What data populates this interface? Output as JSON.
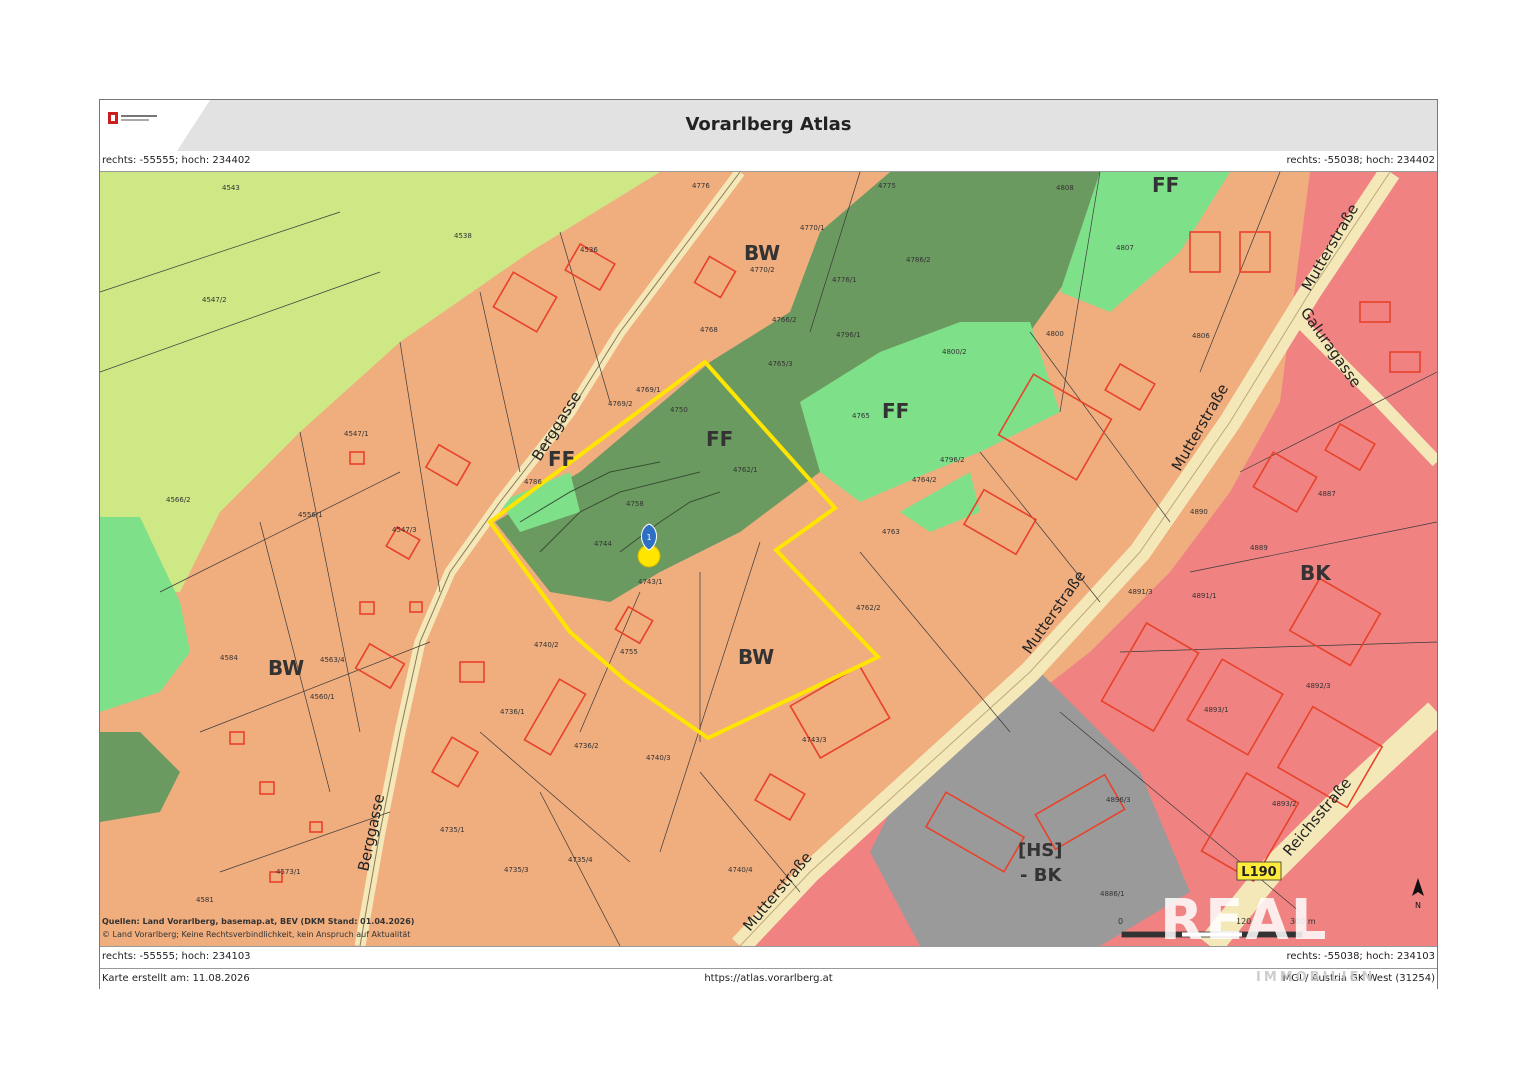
{
  "header": {
    "title": "Vorarlberg Atlas"
  },
  "coords": {
    "top_left": "rechts: -55555; hoch: 234402",
    "top_right": "rechts: -55038; hoch: 234402",
    "bottom_left": "rechts: -55555; hoch: 234103",
    "bottom_right": "rechts: -55038; hoch: 234103"
  },
  "footer": {
    "created": "Karte erstellt am: 11.08.2026",
    "url": "https://atlas.vorarlberg.at",
    "projection": "MGI / Austria GK West (31254)"
  },
  "sources": {
    "line1": "Quellen: Land Vorarlberg, basemap.at, BEV (DKM Stand: 01.04.2026)",
    "line2": "© Land Vorarlberg; Keine Rechtsverbindlichkeit, kein Anspruch auf Aktualität"
  },
  "zones": {
    "bw": "BW",
    "ff": "FF",
    "bk": "BK",
    "hs1": "[HS]",
    "hs2": "- BK"
  },
  "streets": {
    "berggasse": "Berggasse",
    "mutterstrasse": "Mutterstraße",
    "galuragasse": "Galuragasse",
    "reichsstrasse": "Reichsstraße",
    "road_badge": "L190"
  },
  "parcels": [
    "4543",
    "4538",
    "4547/2",
    "4536",
    "4566/2",
    "4547/1",
    "4556/1",
    "4547/3",
    "4762/1",
    "4763",
    "4762/2",
    "4743/1",
    "4740/2",
    "4755",
    "4740/3",
    "4743/3",
    "4740/4",
    "4736/1",
    "4736/2",
    "4735/1",
    "4735/3",
    "4735/4",
    "4581",
    "4573/1",
    "4560/1",
    "4563/4",
    "4584",
    "4796/2",
    "4796/1",
    "4800/2",
    "4765",
    "4764/2",
    "4800",
    "4807",
    "4806",
    "4887",
    "4890",
    "4889",
    "4891/3",
    "4891/1",
    "4892/3",
    "4893/1",
    "4893/2",
    "4896/3",
    "4886/1",
    "4786/2",
    "4766/2",
    "4765/3",
    "4769/1",
    "4769/2",
    "4758",
    "4744",
    "4750",
    "4770/1",
    "4770/2",
    "4776/1",
    "4775",
    "4776",
    "4768",
    "4786",
    "4808"
  ],
  "marker": {
    "label": "1"
  },
  "scale": {
    "start": "0",
    "mid": "120",
    "end": "300 m"
  },
  "north": {
    "label": "N"
  },
  "watermark": {
    "text": "REAL",
    "sub": "IMMOBILIEN"
  },
  "colors": {
    "bw_zone": "#f0ad7e",
    "ff_zone": "#7fe08a",
    "forest": "#6b9a60",
    "agri": "#cde884",
    "bk_zone": "#f08282",
    "special": "#9a9a9a",
    "plot": "#ffe500",
    "building": "#e8422a"
  }
}
